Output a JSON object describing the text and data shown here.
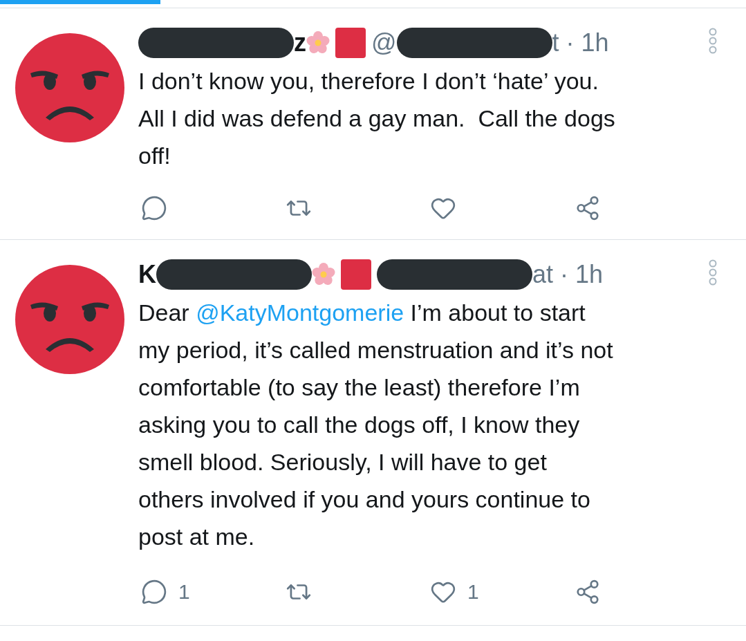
{
  "loading_bar": {
    "level": 0.215
  },
  "tweets": [
    {
      "header": [
        {
          "kind": "redaction"
        },
        {
          "kind": "name",
          "text": "z"
        },
        {
          "kind": "flower"
        },
        {
          "kind": "flag"
        },
        {
          "kind": "meta",
          "text": "@"
        },
        {
          "kind": "redaction"
        },
        {
          "kind": "meta",
          "text": "t · 1h"
        }
      ],
      "body": [
        [
          {
            "text": "I don’t know you, therefore I don’t ‘hate’ you."
          }
        ],
        [
          {
            "text": "All I did was defend a gay man.  Call the dogs"
          }
        ],
        [
          {
            "text": "off!"
          }
        ]
      ],
      "actions": [
        {
          "kind": "reply"
        },
        {
          "kind": "retweet"
        },
        {
          "kind": "like"
        },
        {
          "kind": "share"
        }
      ]
    },
    {
      "header": [
        {
          "kind": "name",
          "text": "K"
        },
        {
          "kind": "redaction"
        },
        {
          "kind": "flower"
        },
        {
          "kind": "flag"
        },
        {
          "kind": "redaction"
        },
        {
          "kind": "meta",
          "text": "at · 1h"
        }
      ],
      "body": [
        [
          {
            "text": "Dear "
          },
          {
            "text": "@KatyMontgomerie",
            "kind": "mention"
          },
          {
            "text": " I’m about to start"
          }
        ],
        [
          {
            "text": "my period, it’s called menstruation and it’s not"
          }
        ],
        [
          {
            "text": "comfortable (to say the least) therefore I’m"
          }
        ],
        [
          {
            "text": "asking you to call the dogs off, I know they"
          }
        ],
        [
          {
            "text": "smell blood. Seriously, I will have to get"
          }
        ],
        [
          {
            "text": "others involved if you and yours continue to"
          }
        ],
        [
          {
            "text": "post at me."
          }
        ]
      ],
      "actions": [
        {
          "kind": "reply",
          "count": "1"
        },
        {
          "kind": "retweet"
        },
        {
          "kind": "like",
          "count": "1"
        },
        {
          "kind": "share"
        }
      ]
    }
  ]
}
